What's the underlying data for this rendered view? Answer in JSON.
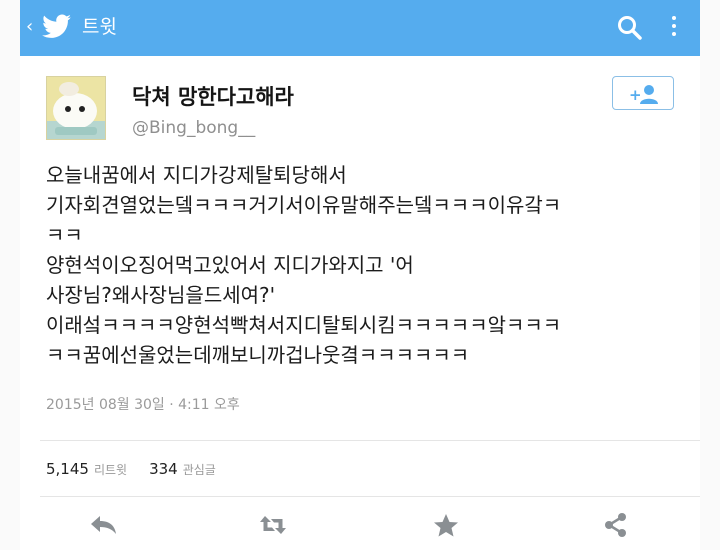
{
  "appbar": {
    "back": "‹",
    "title": "트윗",
    "bird_icon": "twitter-bird-icon",
    "search_icon": "search-icon",
    "overflow_icon": "overflow-menu-icon",
    "color": "#55acee"
  },
  "tweet": {
    "display_name": "닥쳐 망한다고해라",
    "handle": "@Bing_bong__",
    "follow_icon": "follow-user-icon",
    "lines": [
      "오늘내꿈에서 지디가강제탈퇴당해서",
      "기자회견열었는뎈ㅋㅋㅋ거기서이유말해주는뎈ㅋㅋㅋ이유갘ㅋ",
      "ㅋㅋ",
      "양현석이오징어먹고있어서 지디가와지고 '어",
      "사장님?왜사장님을드세여?'",
      "이래섴ㅋㅋㅋㅋ양현석빡쳐서지디탈퇴시킴ㅋㅋㅋㅋㅋ앜ㅋㅋㅋ",
      "ㅋㅋ꿈에선울었는데깨보니까겁나웃곀ㅋㅋㅋㅋㅋㅋ"
    ],
    "timestamp": "2015년 08월 30일 · 4:11 오후"
  },
  "stats": {
    "retweets_count": "5,145",
    "retweets_label": "리트윗",
    "likes_count": "334",
    "likes_label": "관심글"
  },
  "actions": {
    "reply_icon": "reply-icon",
    "retweet_icon": "retweet-icon",
    "favorite_icon": "star-icon",
    "share_icon": "share-icon",
    "icon_color": "#8a8f93"
  }
}
